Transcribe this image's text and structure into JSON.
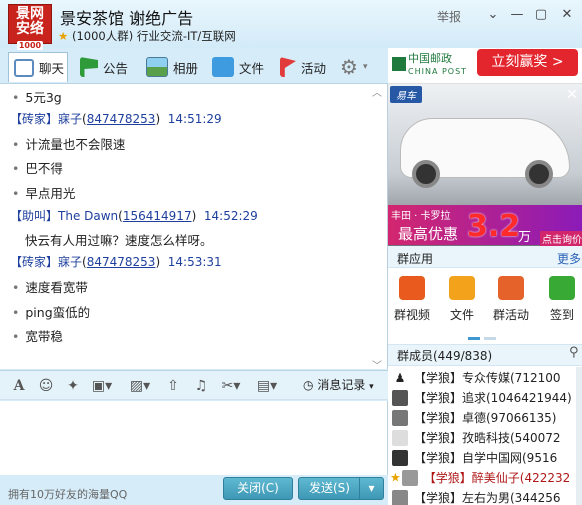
{
  "header": {
    "logo_text": "景网安络",
    "logo_number": "1000",
    "group_name": "景安茶馆 谢绝广告",
    "group_info": "(1000人群) 行业交流-IT/互联网",
    "report": "举报",
    "controls": {
      "dropdown": "⌄",
      "minimize": "—",
      "maximize": "▢",
      "close": "✕"
    }
  },
  "tabs": [
    {
      "label": "聊天",
      "icon": "chat-icon"
    },
    {
      "label": "公告",
      "icon": "flag-icon"
    },
    {
      "label": "相册",
      "icon": "photo-icon"
    },
    {
      "label": "文件",
      "icon": "folder-icon"
    },
    {
      "label": "活动",
      "icon": "event-flag-icon"
    }
  ],
  "chat": {
    "messages": [
      {
        "type": "line",
        "text": "5元3g"
      },
      {
        "type": "header",
        "rank": "【砖家】",
        "nick": "寐子",
        "uid": "847478253",
        "time": "14:51:29"
      },
      {
        "type": "line",
        "text": "计流量也不会限速"
      },
      {
        "type": "line",
        "text": "巴不得"
      },
      {
        "type": "line",
        "text": "早点用光"
      },
      {
        "type": "header",
        "rank": "【助叫】",
        "nick": "The Dawn",
        "uid": "156414917",
        "time": "14:52:29"
      },
      {
        "type": "plain",
        "text": "快云有人用过嘛？速度怎么样呀。"
      },
      {
        "type": "header",
        "rank": "【砖家】",
        "nick": "寐子",
        "uid": "847478253",
        "time": "14:53:31"
      },
      {
        "type": "line",
        "text": "速度看宽带"
      },
      {
        "type": "line",
        "text": "ping蛮低的"
      },
      {
        "type": "line",
        "text": "宽带稳"
      }
    ]
  },
  "input_toolbar": {
    "history": "消息记录"
  },
  "bottom": {
    "ad_text": "拥有10万好友的海量QQ",
    "close_label": "关闭(C)",
    "send_label": "发送(S)"
  },
  "sidebar": {
    "post_logo": "中国邮政",
    "post_logo_en": "CHINA POST",
    "post_button": "立刻赢奖 >",
    "car_ad": {
      "brand": "易车",
      "model": "丰田 · 卡罗拉",
      "offer": "最高优惠",
      "price": "3.2",
      "unit": "万",
      "query": "点击询价"
    },
    "apps_title": "群应用",
    "apps_more": "更多",
    "apps": [
      {
        "label": "群视频",
        "icon": "video-icon",
        "color": "#e85a1e"
      },
      {
        "label": "文件",
        "icon": "folder-icon",
        "color": "#f3a21b"
      },
      {
        "label": "群活动",
        "icon": "activity-icon",
        "color": "#e5632a"
      },
      {
        "label": "签到",
        "icon": "checkin-icon",
        "color": "#39a935"
      }
    ],
    "members_title": "群成员(449/838)",
    "members": [
      {
        "text": "【学狼】专众传媒(712100",
        "color": "#222"
      },
      {
        "text": "【学狼】追求(1046421944)",
        "color": "#222"
      },
      {
        "text": "【学狼】卓德(97066135)",
        "color": "#222"
      },
      {
        "text": "【学狼】孜晧科技(540072",
        "color": "#222"
      },
      {
        "text": "【学狼】自学中国网(9516",
        "color": "#222"
      },
      {
        "text": "【学狼】醉美仙子(422232",
        "color": "#b01818"
      },
      {
        "text": "【学狼】左右为男(344256",
        "color": "#222"
      }
    ]
  }
}
